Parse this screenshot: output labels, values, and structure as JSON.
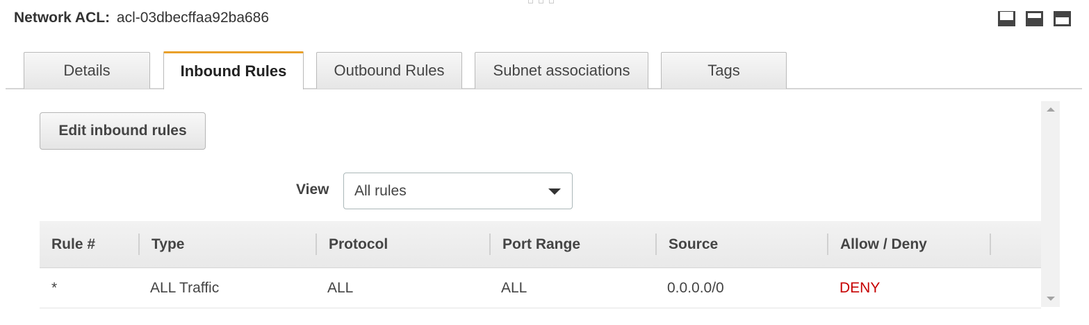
{
  "header": {
    "label": "Network ACL:",
    "acl_id": "acl-03dbecffaa92ba686"
  },
  "tabs": [
    {
      "label": "Details",
      "active": false
    },
    {
      "label": "Inbound Rules",
      "active": true
    },
    {
      "label": "Outbound Rules",
      "active": false
    },
    {
      "label": "Subnet associations",
      "active": false
    },
    {
      "label": "Tags",
      "active": false
    }
  ],
  "actions": {
    "edit_label": "Edit inbound rules"
  },
  "view": {
    "label": "View",
    "selected": "All rules"
  },
  "table": {
    "columns": [
      "Rule #",
      "Type",
      "Protocol",
      "Port Range",
      "Source",
      "Allow / Deny"
    ],
    "rows": [
      [
        "*",
        "ALL Traffic",
        "ALL",
        "ALL",
        "0.0.0.0/0",
        "DENY"
      ]
    ]
  },
  "colors": {
    "active_tab_accent": "#e9a02a",
    "deny": "#c60000"
  },
  "icons": {
    "layout": [
      "panel-bottom-icon",
      "panel-half-icon",
      "panel-full-icon"
    ],
    "select": "caret-down-icon"
  }
}
